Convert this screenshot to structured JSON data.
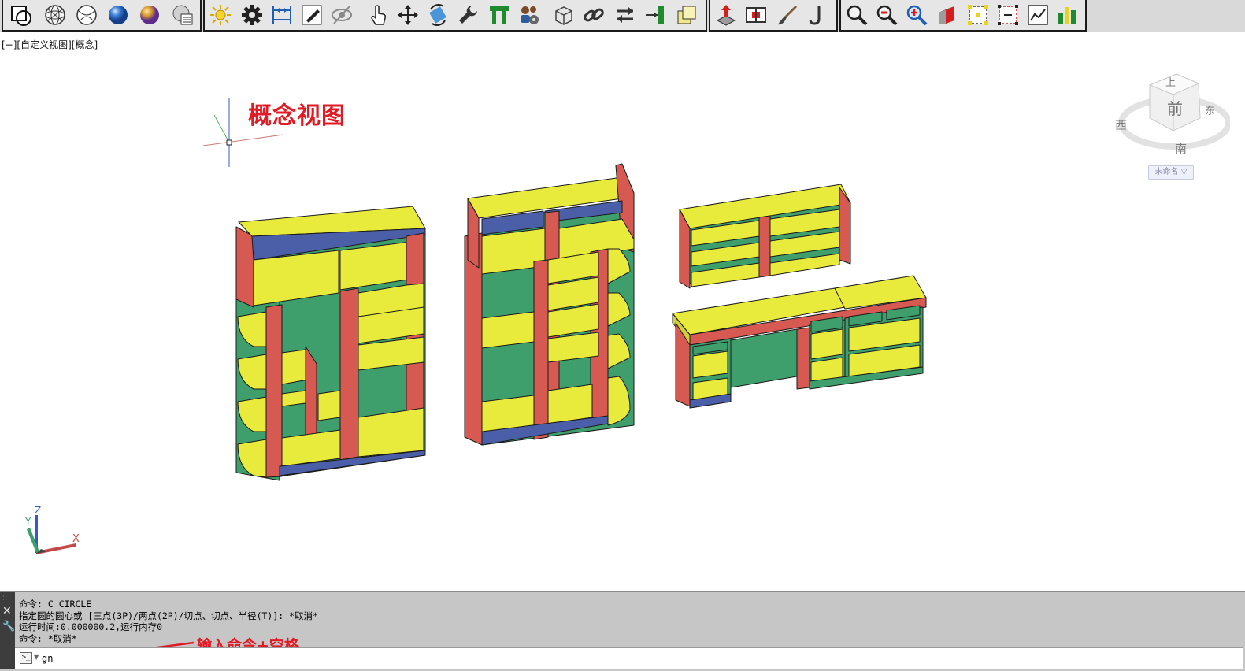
{
  "toolbar": {
    "groups": [
      {
        "name": "visual-styles",
        "items": [
          "region-icon",
          "wireframe-sphere-icon",
          "hidden-sphere-icon",
          "realistic-sphere-icon",
          "conceptual-sphere-icon",
          "visual-style-manager-icon"
        ]
      },
      {
        "name": "tools",
        "items": [
          "sun-icon",
          "settings-gear-icon",
          "dimension-icon",
          "edit-pencil-icon",
          "hide-icon",
          "select-hand-icon",
          "move-icon",
          "rotate-icon",
          "wrench-icon",
          "green-tool-icon",
          "users-settings-icon",
          "box-wireframe-icon",
          "link-icon",
          "swap-icon",
          "export-icon",
          "copy-icon"
        ]
      },
      {
        "name": "modify",
        "items": [
          "extrude-icon",
          "split-icon",
          "brush-icon",
          "hook-icon"
        ]
      },
      {
        "name": "view",
        "items": [
          "zoom-icon",
          "zoom-out-icon",
          "zoom-in-icon",
          "3d-block-icon",
          "frame-select-icon",
          "frame-red-icon",
          "chart-icon",
          "bars-icon"
        ]
      }
    ]
  },
  "viewport": {
    "label": "[−][自定义视图][概念]",
    "annotation_title": "概念视图"
  },
  "viewcube": {
    "top": "上",
    "front": "前",
    "west": "西",
    "east": "东",
    "south": "南",
    "menu_label": "未命名 ▽"
  },
  "ucs": {
    "x_label": "X",
    "y_label": "Y",
    "z_label": "Z"
  },
  "colors": {
    "panel_yellow": "#e8ea3c",
    "panel_red": "#d65a52",
    "panel_green": "#3f9f6c",
    "panel_blue": "#4a5fa8",
    "annotation_red": "#e11b25"
  },
  "command": {
    "history": [
      "命令: C CIRCLE",
      "指定圆的圆心或 [三点(3P)/两点(2P)/切点、切点、半径(T)]: *取消*",
      "运行时间:0.000000.2,运行内存0",
      "命令: *取消*"
    ],
    "input_value": "gn",
    "hint": "输入命令+空格"
  }
}
